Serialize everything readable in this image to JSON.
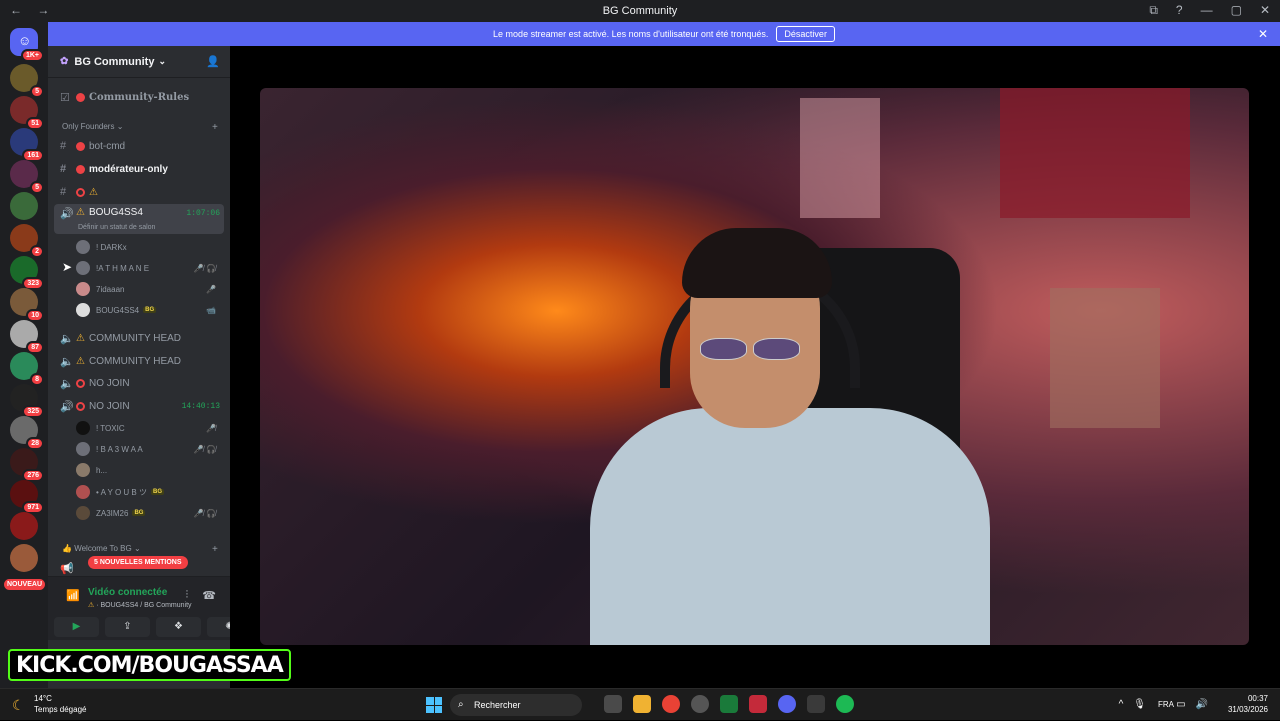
{
  "window": {
    "title": "BG Community",
    "back": "←",
    "forward": "→",
    "min": "—",
    "max": "▢",
    "close": "✕",
    "screen_icon": "screen-share-icon",
    "help_icon": "help-icon"
  },
  "banner": {
    "text": "Le mode streamer est activé. Les noms d'utilisateur ont été tronqués.",
    "button": "Désactiver",
    "close": "✕",
    "color": "#5865f2"
  },
  "servers": {
    "home_badge": "1K+",
    "badges": [
      "5",
      "51",
      "161",
      "5",
      "",
      "2",
      "323",
      "10",
      "87",
      "8",
      "325",
      "28",
      "276",
      "971",
      ""
    ],
    "nouveau": "NOUVEAU"
  },
  "guild": {
    "name": "BG Community",
    "chevron": "⌄",
    "invite_icon": "add-member-icon"
  },
  "channels": {
    "rules": "Community-Rules",
    "category_founders": "Only Founders",
    "bot_cmd": "bot-cmd",
    "moderateur": "modérateur-only",
    "warning_channel": "",
    "boug": "BOUG4SS4",
    "boug_time": "1:07:06",
    "boug_status": "Définir un statut de salon",
    "boug_users": [
      {
        "name": "! DARKx",
        "tag": "",
        "status": ""
      },
      {
        "name": "!A T H M A N E",
        "tag": "",
        "status": "🎤̸ 🎧̸"
      },
      {
        "name": "7idaaan",
        "tag": "",
        "status": "🎤"
      },
      {
        "name": "BOUG4SS4",
        "tag": "BG",
        "status": "📹"
      }
    ],
    "community_head_1": "COMMUNITY HEAD",
    "community_head_2": "COMMUNITY HEAD",
    "no_join_1": "NO JOIN",
    "no_join_2": "NO JOIN",
    "no_join_time": "14:40:13",
    "nojoin_users": [
      {
        "name": "! TOXIC",
        "tag": "",
        "status": "🎤̸"
      },
      {
        "name": "! B A 3 W A A",
        "tag": "",
        "status": "🎤̸ 🎧̸"
      },
      {
        "name": "h...",
        "tag": "",
        "status": ""
      },
      {
        "name": "• A Y O U B ツ",
        "tag": "BG",
        "status": ""
      },
      {
        "name": "ZA3IM26",
        "tag": "BG",
        "status": "🎤̸ 🎧̸"
      }
    ],
    "category_welcome": "Welcome To BG"
  },
  "mentions": "5 NOUVELLES MENTIONS",
  "voice": {
    "status": "Vidéo connectée",
    "channel": "BOUG4SS4 / BG Community"
  },
  "watermark": {
    "k": "K",
    "rest": "KICK.COM/BOUGASSAA"
  },
  "taskbar": {
    "temp": "14°C",
    "weather": "Temps dégagé",
    "search": "Rechercher",
    "lang": "FRA",
    "time": "00:37",
    "date": "31/03/2026"
  }
}
